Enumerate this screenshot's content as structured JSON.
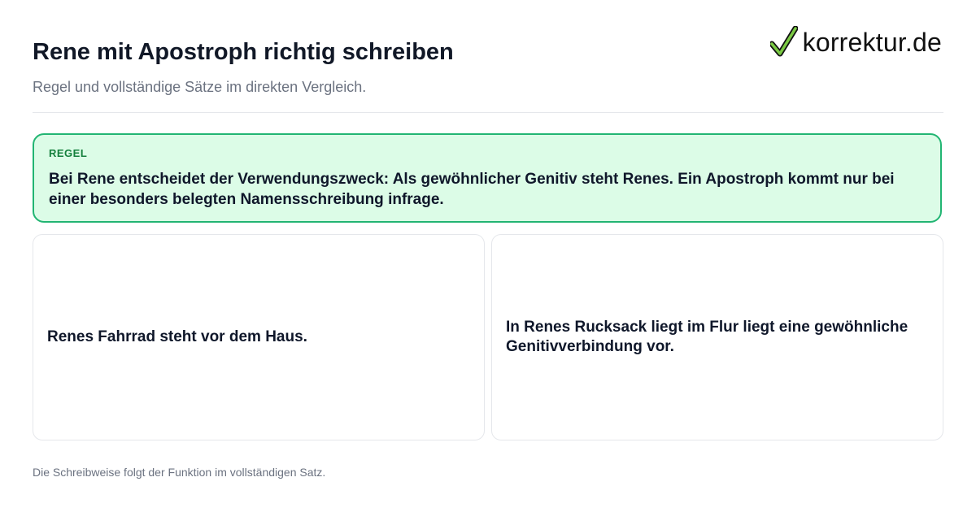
{
  "header": {
    "title": "Rene mit Apostroph richtig schreiben",
    "subtitle": "Regel und vollständige Sätze im direkten Vergleich."
  },
  "logo": {
    "text": "korrektur.de",
    "icon": "checkmark-icon",
    "accent_color": "#7ac943"
  },
  "rule": {
    "label": "REGEL",
    "text": "Bei Rene entscheidet der Verwendungszweck: Als gewöhnlicher Genitiv steht Renes. Ein Apostroph kommt nur bei einer besonders belegten Namensschreibung infrage.",
    "border_color": "#22b573",
    "background_color": "#dcfce7"
  },
  "examples": [
    {
      "text": "Renes Fahrrad steht vor dem Haus."
    },
    {
      "text": "In Renes Rucksack liegt im Flur liegt eine gewöhnliche Genitivverbindung vor."
    }
  ],
  "footer": {
    "text": "Die Schreibweise folgt der Funktion im vollständigen Satz."
  }
}
